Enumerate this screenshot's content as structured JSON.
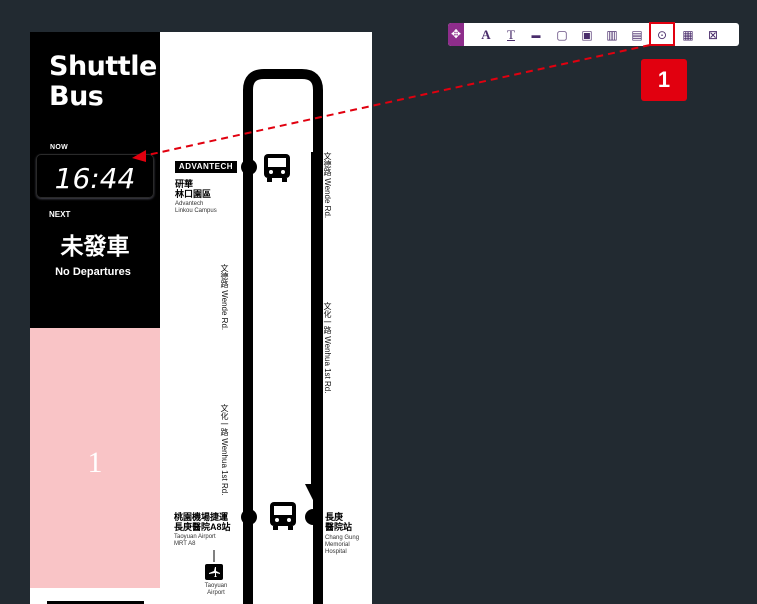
{
  "sign": {
    "title_line1": "Shuttle",
    "title_line2": "Bus",
    "now_label": "NOW",
    "clock": "16:44",
    "next_label": "NEXT",
    "next_zh": "未發車",
    "next_en": "No Departures",
    "pink_number": "1",
    "route": {
      "top_right_zh": "文德路",
      "top_right_en": "Wende Rd.",
      "left_upper_zh": "文德路",
      "left_upper_en": "Wende Rd.",
      "right_mid_zh": "文化一路",
      "right_mid_en": "Wenhua 1st Rd.",
      "left_lower_zh": "文化一路",
      "left_lower_en": "Wenhua 1st Rd."
    },
    "stations": {
      "brand": "ADVANTECH",
      "advantech_zh1": "研華",
      "advantech_zh2": "林口園區",
      "advantech_en1": "Advantech",
      "advantech_en2": "Linkou Campus",
      "mrt_zh1": "桃園機場捷運",
      "mrt_zh2": "長庚醫院A8站",
      "mrt_en1": "Taoyuan Airport",
      "mrt_en2": "MRT A8",
      "airport_en1": "Taoyuan",
      "airport_en2": "Airport",
      "cgmh_zh1": "長庚",
      "cgmh_zh2": "醫院站",
      "cgmh_en1": "Chang Gung",
      "cgmh_en2": "Memorial",
      "cgmh_en3": "Hospital"
    }
  },
  "toolbar": {
    "items": [
      {
        "name": "move-handle",
        "glyph": "✥"
      },
      {
        "name": "text-tool",
        "glyph": "A"
      },
      {
        "name": "text-style-tool",
        "glyph": "T"
      },
      {
        "name": "line-tool",
        "glyph": "▬"
      },
      {
        "name": "rectangle-tool",
        "glyph": "▢"
      },
      {
        "name": "image-tool",
        "glyph": "▣"
      },
      {
        "name": "barcode-tool",
        "glyph": "▥"
      },
      {
        "name": "layout-tool",
        "glyph": "▤"
      },
      {
        "name": "clock-tool",
        "glyph": "⊙"
      },
      {
        "name": "video-tool",
        "glyph": "▦"
      },
      {
        "name": "frame-tool",
        "glyph": "⊠"
      }
    ]
  },
  "annotation": {
    "step_number": "1",
    "highlight_color": "#e1000f"
  }
}
